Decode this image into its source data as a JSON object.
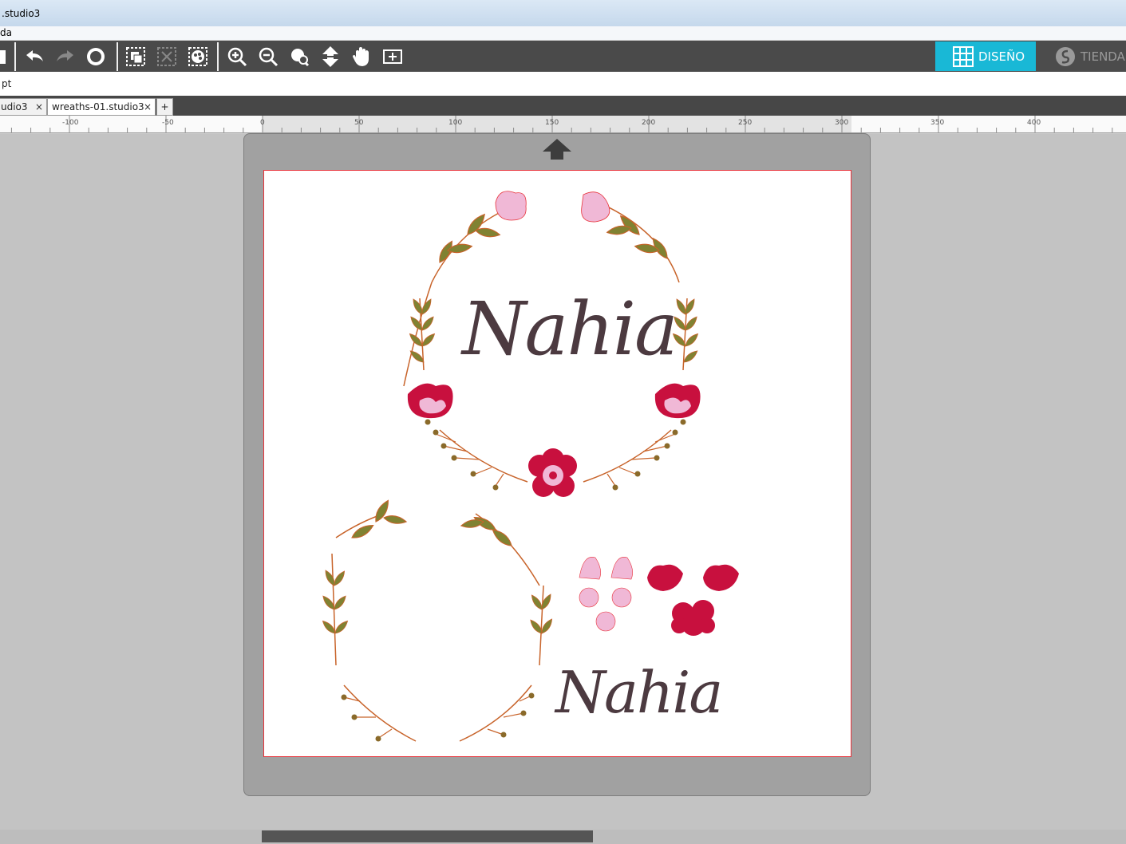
{
  "window": {
    "title": ".studio3"
  },
  "menu": {
    "visible_text": "da"
  },
  "toolbar": {
    "icons": [
      "save-icon",
      "undo-icon",
      "redo-icon",
      "replicate-icon",
      "group-icon",
      "ungroup-icon",
      "fill-icon",
      "zoom-in-icon",
      "zoom-out-icon",
      "zoom-select-icon",
      "pan-down-icon",
      "pan-hand-icon",
      "fit-page-icon"
    ],
    "diseno_label": "DISEÑO",
    "tienda_label": "TIENDA",
    "accent_color": "#19b8d6"
  },
  "properties": {
    "unit_label": "pt"
  },
  "tabs": [
    {
      "label": "udio3",
      "close": "×"
    },
    {
      "label": "wreaths-01.studio3",
      "close": "×"
    }
  ],
  "tab_add": "+",
  "ruler": {
    "labels": [
      "-100",
      "-50",
      "0",
      "50",
      "100",
      "150",
      "200",
      "250",
      "300",
      "350",
      "400"
    ]
  },
  "design": {
    "name_text_1": "Nahia",
    "name_text_2": "Nahia",
    "colors": {
      "leaf": "#808232",
      "stem": "#c8642b",
      "magenta": "#c8103e",
      "pink": "#f0b8d6",
      "cut_line": "#e8333b"
    }
  }
}
